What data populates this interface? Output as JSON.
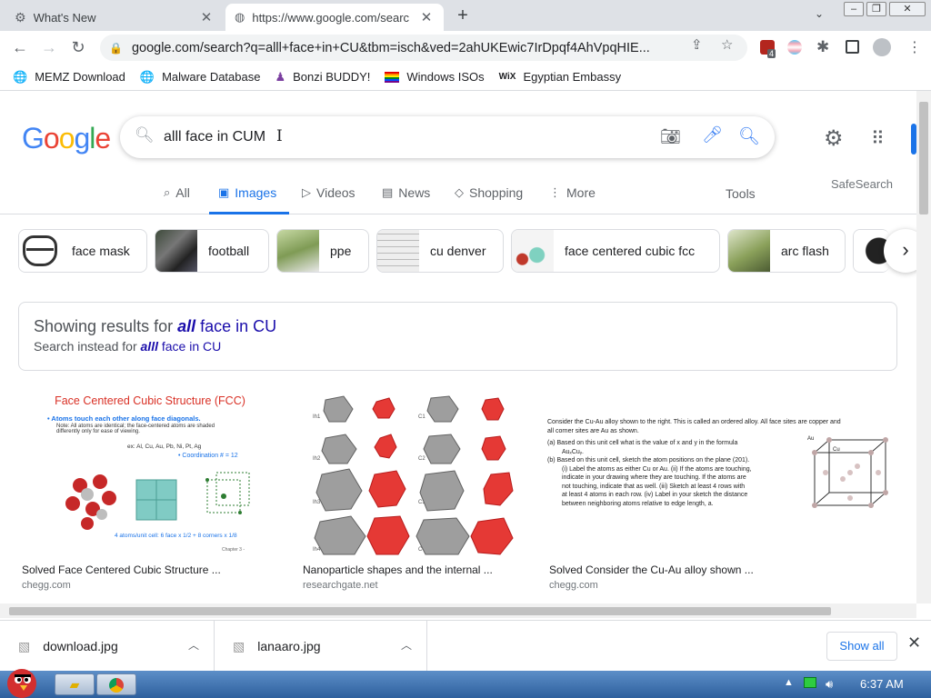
{
  "browser": {
    "tabs": [
      {
        "title": "What's New",
        "icon": "gear-icon"
      },
      {
        "title": "https://www.google.com/searc",
        "icon": "globe-icon"
      }
    ],
    "new_tab_symbol": "+",
    "tab_menu_symbol": "⌄",
    "window_controls": {
      "minimize": "–",
      "restore": "❐",
      "close": "✕"
    },
    "url": "google.com/search?q=alll+face+in+CU&tbm=isch&ved=2ahUKEwic7IrDpqf4AhVpqHIE...",
    "extension_badge": "4"
  },
  "bookmarks": [
    {
      "label": "MEMZ Download",
      "icon": "globe-icon"
    },
    {
      "label": "Malware Database",
      "icon": "globe-icon"
    },
    {
      "label": "Bonzi BUDDY!",
      "icon": "purple-figure-icon"
    },
    {
      "label": "Windows ISOs",
      "icon": "rainbow-flag-icon"
    },
    {
      "label": "Egyptian Embassy",
      "icon": "wix-icon"
    }
  ],
  "google": {
    "logo_letters": [
      "G",
      "o",
      "o",
      "g",
      "l",
      "e"
    ],
    "logo_colors": [
      "#4285f4",
      "#ea4335",
      "#fbbc05",
      "#4285f4",
      "#34a853",
      "#ea4335"
    ],
    "query": "alll face in CUM",
    "caret": "I"
  },
  "search_tabs": [
    {
      "label": "All",
      "icon": "search-icon"
    },
    {
      "label": "Images",
      "icon": "image-icon",
      "active": true
    },
    {
      "label": "Videos",
      "icon": "play-icon"
    },
    {
      "label": "News",
      "icon": "news-icon"
    },
    {
      "label": "Shopping",
      "icon": "tag-icon"
    },
    {
      "label": "More",
      "icon": "kebab-icon"
    }
  ],
  "tools_label": "Tools",
  "safesearch_label": "SafeSearch",
  "chips": [
    {
      "label": "face mask"
    },
    {
      "label": "football"
    },
    {
      "label": "ppe"
    },
    {
      "label": "cu denver"
    },
    {
      "label": "face centered cubic fcc"
    },
    {
      "label": "arc flash"
    }
  ],
  "spelling": {
    "showing_prefix": "Showing results for",
    "showing_corrected": "all",
    "showing_suffix": "face in CU",
    "instead_prefix": "Search instead for",
    "instead_original": "alll",
    "instead_suffix": "face in CU"
  },
  "results": [
    {
      "title": "Solved Face Centered Cubic Structure ...",
      "source": "chegg.com",
      "image_heading": "Face Centered Cubic Structure (FCC)",
      "image_lines": [
        "• Atoms touch each other along face diagonals.",
        "Note: All atoms are identical; the face-centered atoms are shaded differently only for ease of viewing.",
        "ex: Al, Cu, Au, Pb, Ni, Pt, Ag",
        "• Coordination # = 12",
        "4 atoms/unit cell: 6 face x 1/2 + 8 corners x 1/8",
        "Chapter 3 -"
      ]
    },
    {
      "title": "Nanoparticle shapes and the internal ...",
      "source": "researchgate.net",
      "image_labels": [
        "Ih1",
        "C1",
        "Ih2",
        "C2",
        "Ih3",
        "C3",
        "Ih4",
        "C4"
      ]
    },
    {
      "title": "Solved Consider the Cu-Au alloy shown ...",
      "source": "chegg.com",
      "image_lines": [
        "Consider the Cu-Au alloy shown to the right.  This is called an ordered alloy. All face sites are copper and",
        "all corner sites are Au as shown.",
        "(a)  Based on this unit cell what is the value of x and y in the formula",
        "AuₓCuᵧ.",
        "(b)  Based on this unit cell, sketch the atom positions on the plane (201).",
        "(i) Label the atoms as either Cu or Au.  (ii) If the atoms are touching,",
        "indicate in your drawing where they are touching.  If the atoms are",
        "not touching, indicate that as well.  (iii) Sketch at least 4 rows with",
        "at least 4 atoms in each row.  (iv) Label in your sketch the distance",
        "between neighboring atoms relative to edge length, a."
      ],
      "image_atom_labels": [
        "Au",
        "Cu"
      ]
    }
  ],
  "downloads": [
    {
      "name": "download.jpg"
    },
    {
      "name": "lanaaro.jpg"
    }
  ],
  "show_all_label": "Show all",
  "taskbar": {
    "clock": "6:37 AM"
  }
}
